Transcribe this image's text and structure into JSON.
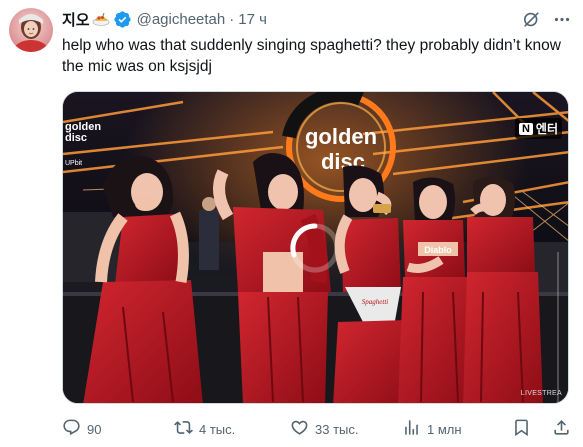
{
  "tweet": {
    "display_name": "지오",
    "handle": "@agicheetah",
    "separator": "·",
    "time": "17 ч",
    "text": "help who was that suddenly singing spaghetti? they probably didn’t know the mic was on ksjsjdj",
    "verified": true,
    "emoji_icon": "spaghetti-emoji-icon"
  },
  "media": {
    "stage_logo_line1": "golden",
    "stage_logo_line2": "disc",
    "corner_logo_line1": "golden",
    "corner_logo_line2": "disc",
    "corner_sponsor": "UPbit",
    "broadcaster_badge": "엔터",
    "broadcaster_letter": "N",
    "watermark": "LIVESTREA",
    "performer_shirt_text": "Diablo",
    "performer_skirt_text": "Spaghetti"
  },
  "actions": {
    "replies": "90",
    "retweets": "4 тыс.",
    "likes": "33 тыс.",
    "views": "1 млн"
  },
  "colors": {
    "accent": "#1d9bf0",
    "secondary_text": "#536471",
    "outfit_red": "#b3141e"
  }
}
